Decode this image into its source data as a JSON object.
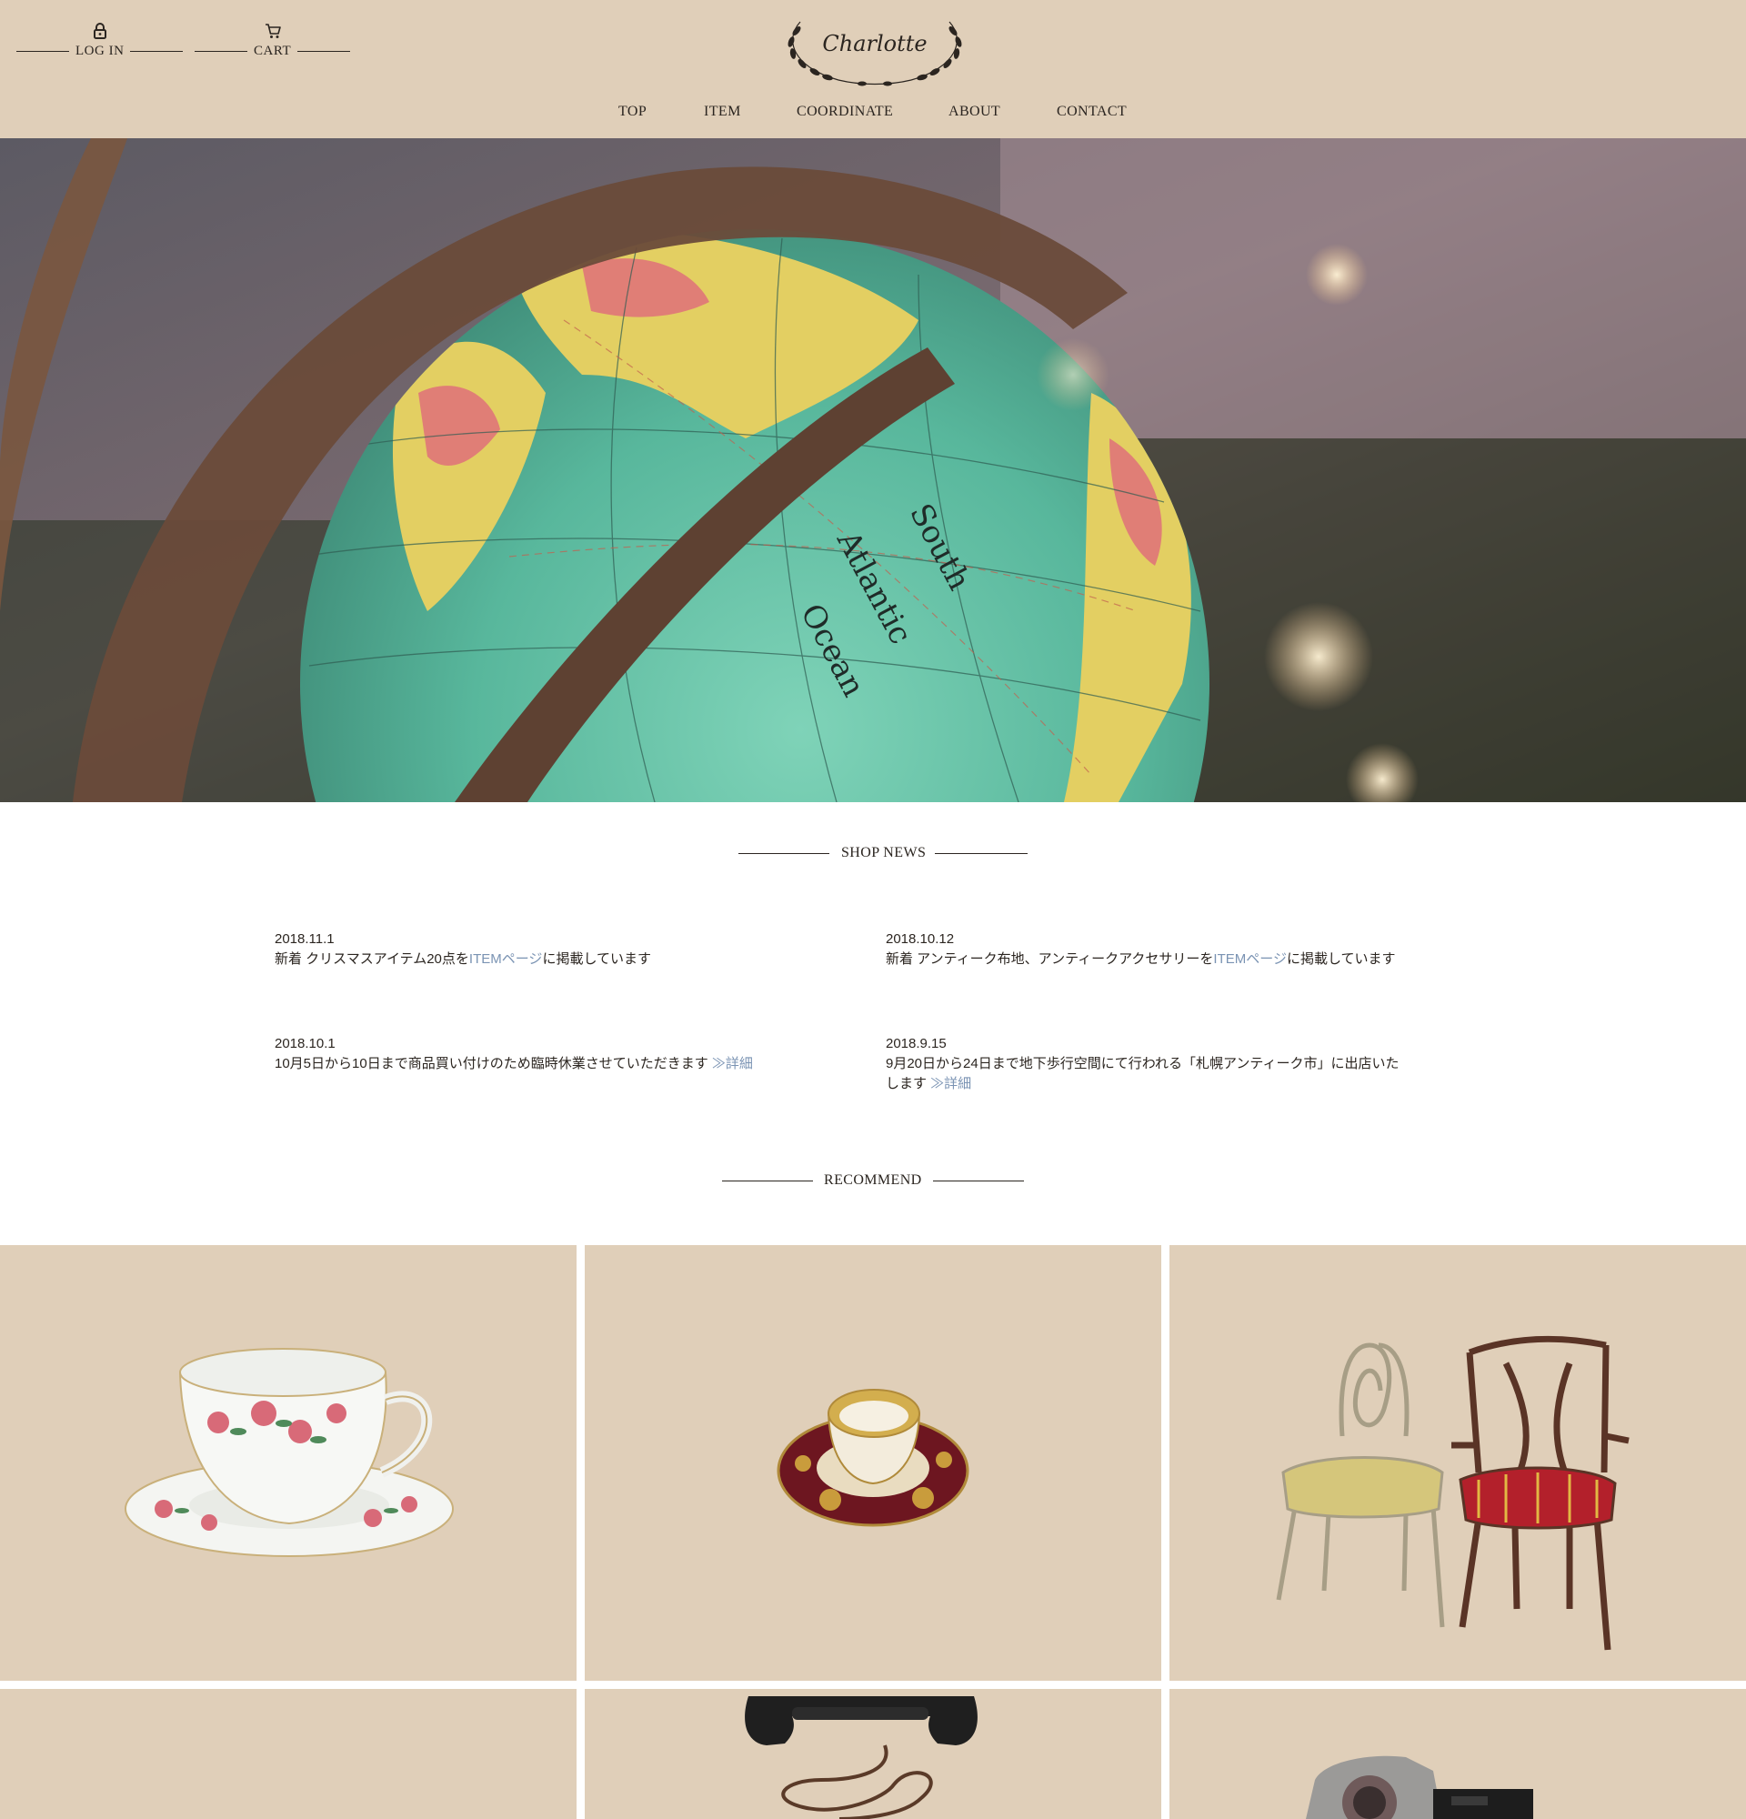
{
  "header": {
    "login_label": "LOG IN",
    "cart_label": "CART",
    "logo_text": "Charlotte",
    "nav": [
      "TOP",
      "ITEM",
      "COORDINATE",
      "ABOUT",
      "CONTACT"
    ]
  },
  "hero": {
    "globe_labels": [
      "South",
      "Atlantic",
      "Ocean"
    ]
  },
  "news": {
    "heading": "SHOP NEWS",
    "items": [
      {
        "date": "2018.11.1",
        "text_before": "新着 クリスマスアイテム20点を",
        "link": "ITEMページ",
        "text_after": "に掲載しています"
      },
      {
        "date": "2018.10.12",
        "text_before": "新着 アンティーク布地、アンティークアクセサリーを",
        "link": "ITEMページ",
        "text_after": "に掲載しています"
      },
      {
        "date": "2018.10.1",
        "text_before": "10月5日から10日まで商品買い付けのため臨時休業させていただきます ",
        "link": "≫詳細",
        "text_after": ""
      },
      {
        "date": "2018.9.15",
        "text_before": "9月20日から24日まで地下歩行空間にて行われる「札幌アンティーク市」に出店いたします ",
        "link": "≫詳細",
        "text_after": ""
      }
    ]
  },
  "recommend": {
    "heading": "RECOMMEND",
    "tiles": [
      {
        "name": "rose-teacup"
      },
      {
        "name": "gold-teacup"
      },
      {
        "name": "antique-chairs"
      },
      {
        "name": "empty"
      },
      {
        "name": "black-telephone"
      },
      {
        "name": "vintage-camera"
      }
    ]
  },
  "colors": {
    "header_bg": "#e0cfb9",
    "tile_bg": "#e0cfb9",
    "text": "#2b2520",
    "link": "#7a93b3"
  }
}
